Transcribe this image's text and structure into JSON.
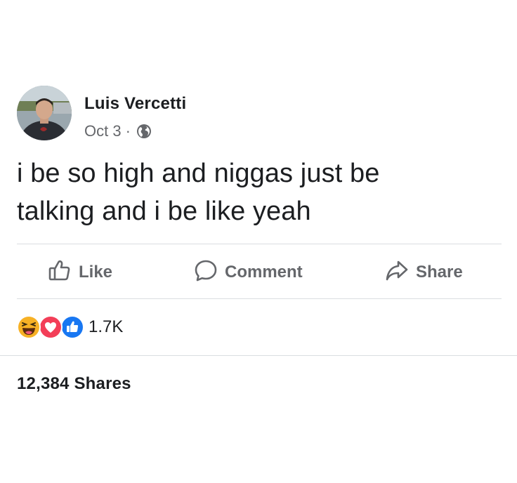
{
  "post": {
    "author": "Luis Vercetti",
    "date": "Oct 3",
    "separator": "·",
    "audience_icon": "globe-icon",
    "text_line1": "i be so high and niggas just be",
    "text_line2": "talking and i be like yeah"
  },
  "actions": {
    "like_label": "Like",
    "like_icon": "thumbs-up-icon",
    "comment_label": "Comment",
    "comment_icon": "comment-bubble-icon",
    "share_label": "Share",
    "share_icon": "share-arrow-icon"
  },
  "reactions": {
    "icons": [
      "haha-icon",
      "love-icon",
      "like-icon"
    ],
    "count": "1.7K"
  },
  "shares": {
    "label": "12,384 Shares"
  },
  "colors": {
    "text": "#1c1e21",
    "secondary_text": "#65676b",
    "divider": "#dadde1",
    "like_blue": "#1877f2",
    "love_red": "#f33e58",
    "haha_yellow": "#f7b125"
  }
}
